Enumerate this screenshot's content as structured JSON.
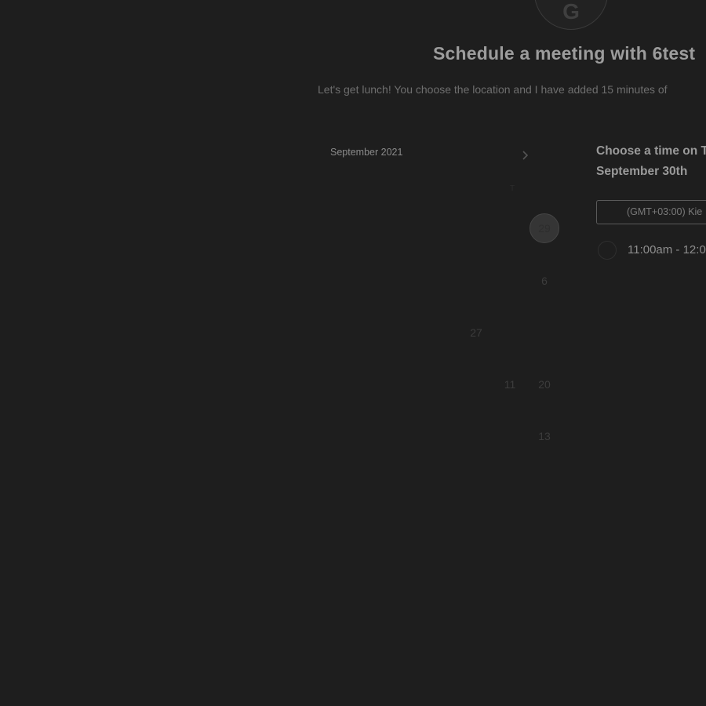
{
  "header": {
    "avatar_initial": "G",
    "title": "Schedule a meeting with 6test",
    "description": "Let's get lunch! You choose the location and I have added 15 minutes of"
  },
  "calendar": {
    "month_label": "September 2021",
    "next_icon": "chevron-right-icon",
    "weekdays": [
      "",
      "",
      "",
      "",
      "",
      "T",
      ""
    ],
    "visible_days": [
      "29",
      "6",
      "27",
      "11",
      "20",
      "13"
    ],
    "selected_day": "29"
  },
  "time_panel": {
    "heading_line1": "Choose a time on T",
    "heading_line2": "September 30th",
    "timezone": "(GMT+03:00) Kie",
    "slots": [
      {
        "label": "11:00am - 12:0"
      }
    ]
  }
}
